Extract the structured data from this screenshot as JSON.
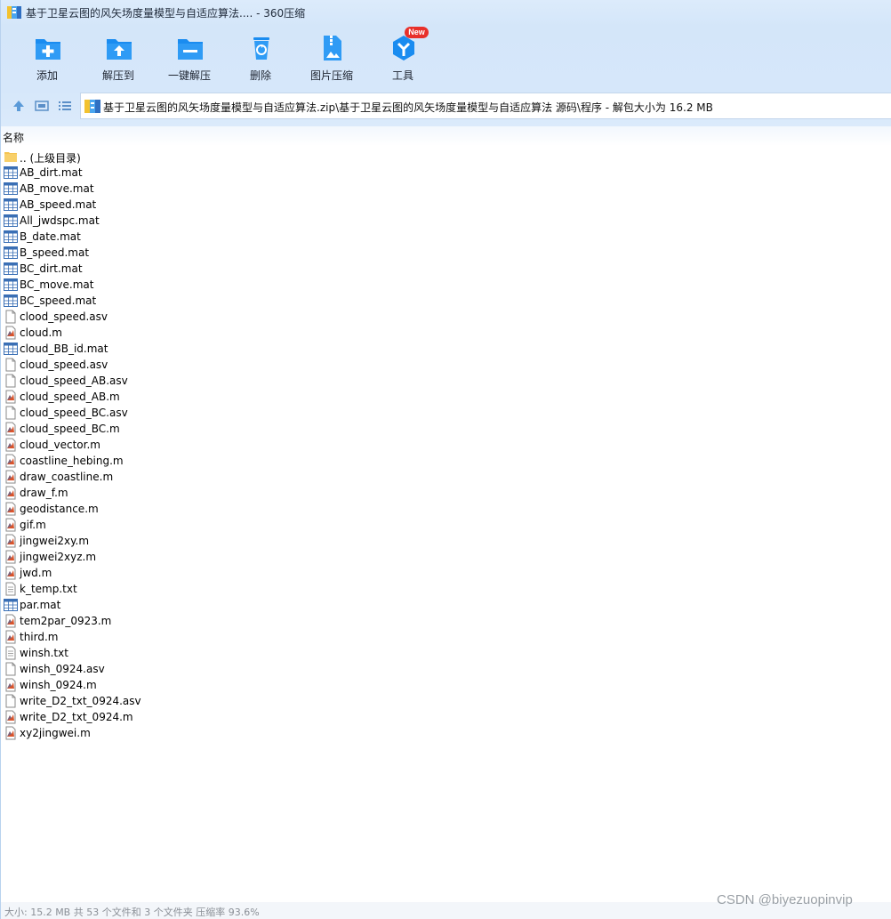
{
  "window": {
    "title": "基于卫星云图的风矢场度量模型与自适应算法.... - 360压缩"
  },
  "toolbar": {
    "items": [
      {
        "label": "添加",
        "icon": "add-icon"
      },
      {
        "label": "解压到",
        "icon": "extract-to-icon"
      },
      {
        "label": "一键解压",
        "icon": "one-click-extract-icon"
      },
      {
        "label": "删除",
        "icon": "delete-icon"
      },
      {
        "label": "图片压缩",
        "icon": "image-compress-icon"
      },
      {
        "label": "工具",
        "icon": "tools-icon"
      }
    ],
    "new_badge": "New"
  },
  "nav": {
    "up": "up-arrow-icon",
    "view_thumbnail": "thumbnail-view-icon",
    "view_list": "list-view-icon"
  },
  "address": {
    "path": "基于卫星云图的风矢场度量模型与自适应算法.zip\\基于卫星云图的风矢场度量模型与自适应算法 源码\\程序 - 解包大小为 16.2 MB"
  },
  "list": {
    "column_header": "名称",
    "files": [
      {
        "name": ".. (上级目录)",
        "type": "folder"
      },
      {
        "name": "AB_dirt.mat",
        "type": "mat"
      },
      {
        "name": "AB_move.mat",
        "type": "mat"
      },
      {
        "name": "AB_speed.mat",
        "type": "mat"
      },
      {
        "name": "All_jwdspc.mat",
        "type": "mat"
      },
      {
        "name": "B_date.mat",
        "type": "mat"
      },
      {
        "name": "B_speed.mat",
        "type": "mat"
      },
      {
        "name": "BC_dirt.mat",
        "type": "mat"
      },
      {
        "name": "BC_move.mat",
        "type": "mat"
      },
      {
        "name": "BC_speed.mat",
        "type": "mat"
      },
      {
        "name": "clood_speed.asv",
        "type": "blank"
      },
      {
        "name": "cloud.m",
        "type": "m"
      },
      {
        "name": "cloud_BB_id.mat",
        "type": "mat"
      },
      {
        "name": "cloud_speed.asv",
        "type": "blank"
      },
      {
        "name": "cloud_speed_AB.asv",
        "type": "blank"
      },
      {
        "name": "cloud_speed_AB.m",
        "type": "m"
      },
      {
        "name": "cloud_speed_BC.asv",
        "type": "blank"
      },
      {
        "name": "cloud_speed_BC.m",
        "type": "m"
      },
      {
        "name": "cloud_vector.m",
        "type": "m"
      },
      {
        "name": "coastline_hebing.m",
        "type": "m"
      },
      {
        "name": "draw_coastline.m",
        "type": "m"
      },
      {
        "name": "draw_f.m",
        "type": "m"
      },
      {
        "name": "geodistance.m",
        "type": "m"
      },
      {
        "name": "gif.m",
        "type": "m"
      },
      {
        "name": "jingwei2xy.m",
        "type": "m"
      },
      {
        "name": "jingwei2xyz.m",
        "type": "m"
      },
      {
        "name": "jwd.m",
        "type": "m"
      },
      {
        "name": "k_temp.txt",
        "type": "txt"
      },
      {
        "name": "par.mat",
        "type": "mat"
      },
      {
        "name": "tem2par_0923.m",
        "type": "m"
      },
      {
        "name": "third.m",
        "type": "m"
      },
      {
        "name": "winsh.txt",
        "type": "txt"
      },
      {
        "name": "winsh_0924.asv",
        "type": "blank"
      },
      {
        "name": "winsh_0924.m",
        "type": "m"
      },
      {
        "name": "write_D2_txt_0924.asv",
        "type": "blank"
      },
      {
        "name": "write_D2_txt_0924.m",
        "type": "m"
      },
      {
        "name": "xy2jingwei.m",
        "type": "m"
      }
    ]
  },
  "status": {
    "text": "大小: 15.2 MB 共 53 个文件和 3 个文件夹 压缩率 93.6%"
  },
  "watermark": "CSDN @biyezuopinvip",
  "colors": {
    "toolbar_bg": "#d6e7fa",
    "icon_blue": "#1a8cf0",
    "badge_red": "#e8302a"
  }
}
